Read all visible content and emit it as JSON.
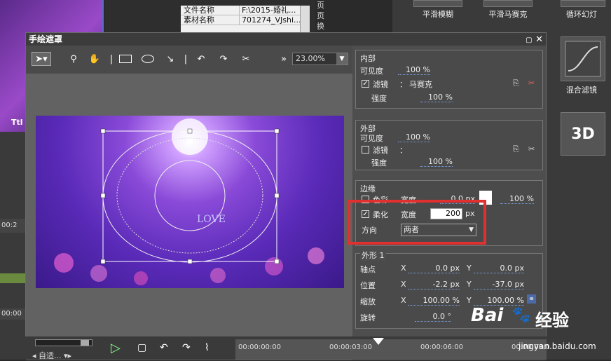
{
  "background": {
    "left_strip_label": "Ttl",
    "info_table": [
      {
        "key": "文件名称",
        "value": "F:\\2015-婚礼..."
      },
      {
        "key": "素材名称",
        "value": "701274_VJshi..."
      }
    ],
    "side_chars": [
      "页",
      "页",
      "换"
    ],
    "bins": [
      {
        "label": "平滑模糊"
      },
      {
        "label": "平滑马赛克"
      },
      {
        "label": "循环幻灯"
      },
      {
        "label": "混合滤镜"
      },
      {
        "label": "3D"
      }
    ]
  },
  "dialog": {
    "title": "手绘遮罩",
    "close": "✕",
    "toolbar": {
      "zoom": "23.00%"
    },
    "inner": {
      "title": "内部",
      "visibility_label": "可见度",
      "visibility_value": "100 %",
      "filter_label": "滤镜",
      "filter_checked": true,
      "filter_value": "马赛克",
      "strength_label": "强度",
      "strength_value": "100 %"
    },
    "outer": {
      "title": "外部",
      "visibility_label": "可见度",
      "visibility_value": "100 %",
      "filter_label": "滤镜",
      "filter_checked": false,
      "filter_value": "",
      "strength_label": "强度",
      "strength_value": "100 %"
    },
    "edge": {
      "title": "边缘",
      "color_label": "色彩",
      "width_label_top": "宽度",
      "width_top_value": "0.0 px",
      "opacity_value": "100 %",
      "soften_label": "柔化",
      "soften_checked": true,
      "width_label": "宽度",
      "width_value": "200",
      "width_unit": "px",
      "direction_label": "方向",
      "direction_value": "两者"
    },
    "shape": {
      "title": "外形 1",
      "anchor_label": "轴点",
      "anchor_x": "0.0 px",
      "anchor_y": "0.0 px",
      "position_label": "位置",
      "position_x": "-2.2 px",
      "position_y": "-37.0 px",
      "scale_label": "缩放",
      "scale_x": "100.00 %",
      "scale_y": "100.00 %",
      "rotate_label": "旋转",
      "rotate_value": "0.0 °",
      "x": "X",
      "y": "Y"
    }
  },
  "bottom": {
    "fit_label": "自适...",
    "timecodes": [
      "00:00:00:00",
      "00:00:03:00",
      "00:00:06:00",
      "00:00:09:0"
    ]
  },
  "left_labels": {
    "time1": "00:2",
    "time2": "00:00"
  },
  "watermark": {
    "brand": "Bai",
    "sub": "经验",
    "url": "jingyan.baidu.com"
  }
}
